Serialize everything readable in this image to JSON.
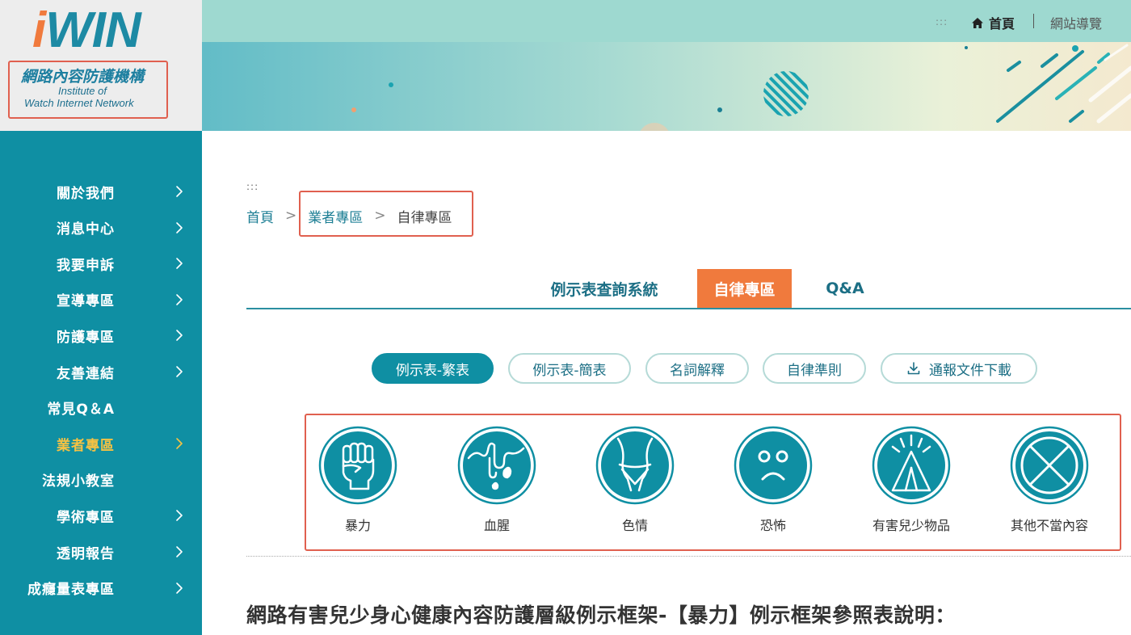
{
  "logo": {
    "brand_i": "i",
    "brand_rest": "WIN",
    "name_cn": "網路內容防護機構",
    "name_en_line1": "Institute of",
    "name_en_line2": "Watch Internet Network"
  },
  "header": {
    "dots": ":::",
    "home": "首頁",
    "sitemap": "網站導覽"
  },
  "sidebar": {
    "items": [
      {
        "label": "關於我們",
        "chevron": true
      },
      {
        "label": "消息中心",
        "chevron": true
      },
      {
        "label": "我要申訴",
        "chevron": true
      },
      {
        "label": "宣導專區",
        "chevron": true
      },
      {
        "label": "防護專區",
        "chevron": true
      },
      {
        "label": "友善連結",
        "chevron": true
      },
      {
        "label": "常見Q＆A",
        "chevron": false
      },
      {
        "label": "業者專區",
        "chevron": true,
        "active": true
      },
      {
        "label": "法規小教室",
        "chevron": false
      },
      {
        "label": "學術專區",
        "chevron": true
      },
      {
        "label": "透明報告",
        "chevron": true
      },
      {
        "label": "成癮量表專區",
        "chevron": true
      }
    ]
  },
  "breadcrumb": {
    "dots": ":::",
    "home": "首頁",
    "sep": ">",
    "vendor": "業者專區",
    "current": "自律專區"
  },
  "tabs": {
    "t1": "例示表查詢系統",
    "t2": "自律專區",
    "t3": "Q&A"
  },
  "pills": {
    "p1": "例示表-繁表",
    "p2": "例示表-簡表",
    "p3": "名詞解釋",
    "p4": "自律準則",
    "p5": "通報文件下載"
  },
  "categories": [
    {
      "label": "暴力",
      "icon": "fist-icon"
    },
    {
      "label": "血腥",
      "icon": "blood-icon"
    },
    {
      "label": "色情",
      "icon": "body-icon"
    },
    {
      "label": "恐怖",
      "icon": "scared-face-icon"
    },
    {
      "label": "有害兒少物品",
      "icon": "tent-icon"
    },
    {
      "label": "其他不當內容",
      "icon": "cross-circle-icon"
    }
  ],
  "heading": "網路有害兒少身心健康內容防護層級例示框架-【暴力】例示框架參照表說明：",
  "colors": {
    "teal": "#0f8fa3",
    "orange": "#f07a3d",
    "active_nav": "#f6c243",
    "annotation_red": "#e0604f"
  }
}
